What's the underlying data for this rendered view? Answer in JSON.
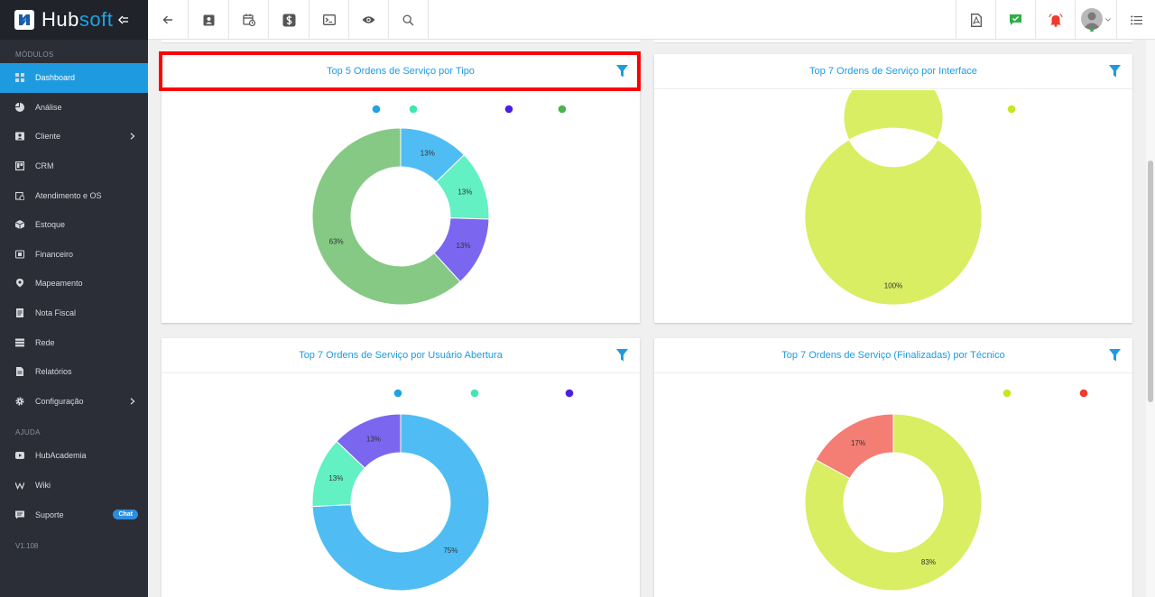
{
  "app": {
    "brand_main": "Hub",
    "brand_accent": "soft"
  },
  "sidebar": {
    "section_modules": "MÓDULOS",
    "section_help": "AJUDA",
    "version": "V1.108",
    "items": [
      {
        "key": "dashboard",
        "label": "Dashboard",
        "icon": "dashboard-icon",
        "active": true,
        "chevron": false
      },
      {
        "key": "analise",
        "label": "Análise",
        "icon": "chart-pie-icon",
        "active": false,
        "chevron": false
      },
      {
        "key": "cliente",
        "label": "Cliente",
        "icon": "contact-card-icon",
        "active": false,
        "chevron": true
      },
      {
        "key": "crm",
        "label": "CRM",
        "icon": "crm-board-icon",
        "active": false,
        "chevron": false
      },
      {
        "key": "atendimento",
        "label": "Atendimento e OS",
        "icon": "calendar-clock-icon",
        "active": false,
        "chevron": false
      },
      {
        "key": "estoque",
        "label": "Estoque",
        "icon": "box-icon",
        "active": false,
        "chevron": false
      },
      {
        "key": "financeiro",
        "label": "Financeiro",
        "icon": "money-icon",
        "active": false,
        "chevron": false
      },
      {
        "key": "mapeamento",
        "label": "Mapeamento",
        "icon": "map-pin-icon",
        "active": false,
        "chevron": false
      },
      {
        "key": "nota-fiscal",
        "label": "Nota Fiscal",
        "icon": "document-icon",
        "active": false,
        "chevron": false
      },
      {
        "key": "rede",
        "label": "Rede",
        "icon": "server-icon",
        "active": false,
        "chevron": false
      },
      {
        "key": "relatorios",
        "label": "Relatórios",
        "icon": "report-icon",
        "active": false,
        "chevron": false
      },
      {
        "key": "configuracao",
        "label": "Configuração",
        "icon": "gear-icon",
        "active": false,
        "chevron": true
      }
    ],
    "help_items": [
      {
        "key": "hubacademia",
        "label": "HubAcademia",
        "icon": "video-icon"
      },
      {
        "key": "wiki",
        "label": "Wiki",
        "icon": "wiki-icon"
      },
      {
        "key": "suporte",
        "label": "Suporte",
        "icon": "chat-icon",
        "badge": "Chat"
      }
    ]
  },
  "cards": [
    {
      "title": "Top 5 Ordens de Serviço por Tipo",
      "highlighted": true
    },
    {
      "title": "Top 7 Ordens de Serviço por Interface",
      "highlighted": false
    },
    {
      "title": "Top 7 Ordens de Serviço por Usuário Abertura",
      "highlighted": false
    },
    {
      "title": "Top 7 Ordens de Serviço (Finalizadas) por Técnico",
      "highlighted": false
    }
  ],
  "chart_data": [
    {
      "type": "pie",
      "variant": "donut",
      "title": "Top 5 Ordens de Serviço por Tipo",
      "legend_placement": "top",
      "legend_markers": [
        "#1fa2e6",
        "#3de8b4",
        "#4b1fe0",
        "#4ab34a"
      ],
      "series": [
        {
          "value": 13,
          "label": "13%",
          "color": "#4fbdf3"
        },
        {
          "value": 13,
          "label": "13%",
          "color": "#63f0c3"
        },
        {
          "value": 13,
          "label": "13%",
          "color": "#7b66f0"
        },
        {
          "value": 63,
          "label": "63%",
          "color": "#85c985"
        }
      ]
    },
    {
      "type": "pie",
      "variant": "donut",
      "title": "Top 7 Ordens de Serviço por Interface",
      "legend_placement": "top",
      "legend_markers": [
        "#c8e61f"
      ],
      "series": [
        {
          "value": 100,
          "label": "100%",
          "color": "#d9ee62"
        }
      ]
    },
    {
      "type": "pie",
      "variant": "donut",
      "title": "Top 7 Ordens de Serviço por Usuário Abertura",
      "legend_placement": "top",
      "legend_markers": [
        "#1fa2e6",
        "#3de8b4",
        "#4b1fe0"
      ],
      "series": [
        {
          "value": 75,
          "label": "75%",
          "color": "#4fbdf3"
        },
        {
          "value": 13,
          "label": "13%",
          "color": "#63f0c3"
        },
        {
          "value": 13,
          "label": "13%",
          "color": "#7b66f0"
        }
      ]
    },
    {
      "type": "pie",
      "variant": "donut",
      "title": "Top 7 Ordens de Serviço (Finalizadas) por Técnico",
      "legend_placement": "top",
      "legend_markers": [
        "#c8e61f",
        "#ef3a2f"
      ],
      "series": [
        {
          "value": 83,
          "label": "83%",
          "color": "#d9ee62"
        },
        {
          "value": 17,
          "label": "17%",
          "color": "#f47d74"
        }
      ]
    }
  ],
  "colors": {
    "accent": "#1e9be0",
    "sidebar_bg": "#2b2e36",
    "highlight": "#ff0000"
  }
}
